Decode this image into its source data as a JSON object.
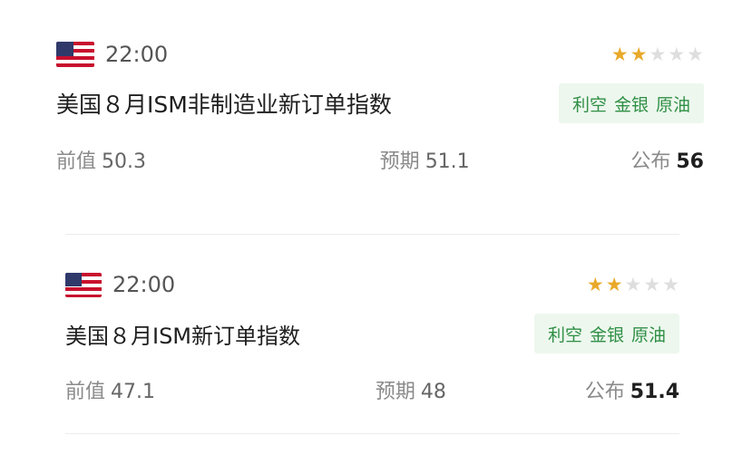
{
  "events": [
    {
      "time": "22:00",
      "stars": 2,
      "stars_total": 5,
      "title": "美国８月ISM非制造业新订单指数",
      "tags": [
        "利空",
        "金银",
        "原油"
      ],
      "previous_label": "前值",
      "previous_value": "50.3",
      "forecast_label": "预期",
      "forecast_value": "51.1",
      "actual_label": "公布",
      "actual_value": "56"
    },
    {
      "time": "22:00",
      "stars": 2,
      "stars_total": 5,
      "title": "美国８月ISM新订单指数",
      "tags": [
        "利空",
        "金银",
        "原油"
      ],
      "previous_label": "前值",
      "previous_value": "47.1",
      "forecast_label": "预期",
      "forecast_value": "48",
      "actual_label": "公布",
      "actual_value": "51.4"
    }
  ],
  "colors": {
    "star_on": "#e9a92a",
    "star_off": "#dedede",
    "tag_bg": "#edf7ee",
    "tag_text": "#2f8f45"
  },
  "icons": {
    "flag": "us-flag-icon",
    "star": "star-icon"
  }
}
